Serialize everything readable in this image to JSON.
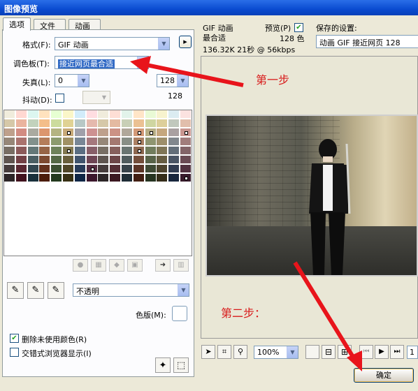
{
  "window": {
    "title": "图像预览"
  },
  "tabs": [
    {
      "label": "选项"
    },
    {
      "label": "文件"
    },
    {
      "label": "动画"
    }
  ],
  "options": {
    "format_label": "格式(F):",
    "format_value": "GIF 动画",
    "palette_label": "调色板(T):",
    "palette_value": "接近网页最合适",
    "loss_label": "失真(L):",
    "loss_value": "0",
    "dither_label": "抖动(D):",
    "colors_value": "128",
    "colors_count": "128",
    "arrow_btn": "▸"
  },
  "swatch_tools": {
    "transparency_label": "不透明",
    "matte_label": "色版(M):"
  },
  "checks": {
    "remove_unused_label": "删除未使用颜色(R)",
    "interlaced_label": "交错式浏览器显示(I)"
  },
  "preview_info": {
    "format": "GIF 动画",
    "palette": "最合适",
    "preview_label": "预览(P)",
    "colors": "128 色",
    "size_line": "136.32K 21秒 @ 56kbps"
  },
  "saved_settings": {
    "label": "保存的设置:",
    "value": "动画 GIF 接近网页 128"
  },
  "annotations": {
    "step1": "第一步",
    "step2": "第二步："
  },
  "bottom": {
    "zoom": "100%",
    "frame": "1"
  },
  "ok_button": "确定",
  "colors": {
    "arrow_red": "#e8141b",
    "title_blue": "#0a4bd0",
    "check_green": "#21a121"
  }
}
